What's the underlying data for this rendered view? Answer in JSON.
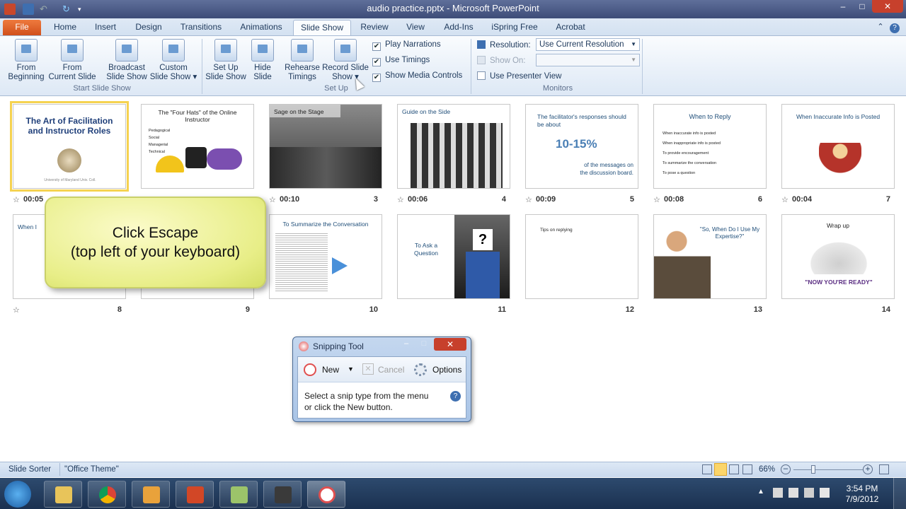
{
  "window": {
    "title": "audio practice.pptx - Microsoft PowerPoint"
  },
  "tabs": [
    {
      "label": "File"
    },
    {
      "label": "Home"
    },
    {
      "label": "Insert"
    },
    {
      "label": "Design"
    },
    {
      "label": "Transitions"
    },
    {
      "label": "Animations"
    },
    {
      "label": "Slide Show"
    },
    {
      "label": "Review"
    },
    {
      "label": "View"
    },
    {
      "label": "Add-Ins"
    },
    {
      "label": "iSpring Free"
    },
    {
      "label": "Acrobat"
    }
  ],
  "ribbon": {
    "start": {
      "group_label": "Start Slide Show",
      "buttons": [
        {
          "line1": "From",
          "line2": "Beginning"
        },
        {
          "line1": "From",
          "line2": "Current Slide"
        },
        {
          "line1": "Broadcast",
          "line2": "Slide Show"
        },
        {
          "line1": "Custom",
          "line2": "Slide Show ▾"
        }
      ]
    },
    "setup": {
      "group_label": "Set Up",
      "buttons": [
        {
          "line1": "Set Up",
          "line2": "Slide Show"
        },
        {
          "line1": "Hide",
          "line2": "Slide"
        },
        {
          "line1": "Rehearse",
          "line2": "Timings"
        },
        {
          "line1": "Record Slide",
          "line2": "Show ▾"
        }
      ],
      "checks": [
        {
          "label": "Play Narrations",
          "checked": true
        },
        {
          "label": "Use Timings",
          "checked": true
        },
        {
          "label": "Show Media Controls",
          "checked": true
        }
      ]
    },
    "monitors": {
      "group_label": "Monitors",
      "resolution_label": "Resolution:",
      "resolution_value": "Use Current Resolution",
      "show_on_label": "Show On:",
      "presenter_label": "Use Presenter View"
    }
  },
  "slides": [
    {
      "num": "",
      "time": "00:05",
      "title": "The Art of Facilitation and Instructor Roles",
      "sub": "University of Maryland Univ. Coll."
    },
    {
      "num": "",
      "time": "",
      "title": "The \"Four Hats\" of the Online Instructor",
      "bullets": [
        "Pedagogical",
        "Social",
        "Managerial",
        "Technical"
      ]
    },
    {
      "num": "3",
      "time": "00:10",
      "title": "Sage on the Stage"
    },
    {
      "num": "4",
      "time": "00:06",
      "title": "Guide on the Side"
    },
    {
      "num": "5",
      "time": "00:09",
      "title": "The facilitator's responses should be about",
      "big": "10-15%",
      "sub": "of the messages on the discussion board."
    },
    {
      "num": "6",
      "time": "00:08",
      "title": "When to Reply",
      "bullets": [
        "When inaccurate info is posted",
        "When inappropriate info is posted",
        "To provide encouragement",
        "To summarize the conversation",
        "To pose a question"
      ]
    },
    {
      "num": "7",
      "time": "00:04",
      "title": "When Inaccurate Info is Posted"
    },
    {
      "num": "8",
      "time": "",
      "title": "When I"
    },
    {
      "num": "9",
      "time": "",
      "title": ""
    },
    {
      "num": "10",
      "time": "",
      "title": "To Summarize the Conversation"
    },
    {
      "num": "11",
      "time": "",
      "title": "To Ask a Question"
    },
    {
      "num": "12",
      "time": "",
      "title": "Tips on replying"
    },
    {
      "num": "13",
      "time": "",
      "title": "\"So, When Do I Use My Expertise?\""
    },
    {
      "num": "14",
      "time": "",
      "title": "Wrap up",
      "big": "\"NOW YOU'RE READY\""
    }
  ],
  "callout": {
    "line1": "Click Escape",
    "line2": "(top left of your keyboard)"
  },
  "snipping": {
    "title": "Snipping Tool",
    "new": "New",
    "cancel": "Cancel",
    "options": "Options",
    "msg1": "Select a snip type from the menu",
    "msg2": "or click the New button."
  },
  "status": {
    "view": "Slide Sorter",
    "theme": "\"Office Theme\"",
    "zoom": "66%"
  },
  "clock": {
    "time": "3:54 PM",
    "date": "7/9/2012"
  },
  "colors": {
    "accent": "#d1501b",
    "selection": "#f5d250",
    "ribbon_text": "#1e395b"
  }
}
